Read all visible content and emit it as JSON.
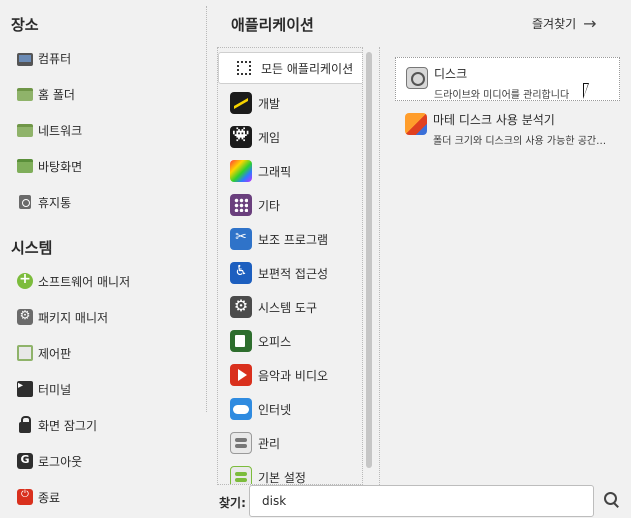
{
  "places": {
    "title": "장소",
    "items": [
      {
        "label": "컴퓨터",
        "icon": "computer-icon"
      },
      {
        "label": "홈 폴더",
        "icon": "home-folder-icon"
      },
      {
        "label": "네트워크",
        "icon": "network-icon"
      },
      {
        "label": "바탕화면",
        "icon": "desktop-icon"
      },
      {
        "label": "휴지통",
        "icon": "trash-icon"
      }
    ]
  },
  "system": {
    "title": "시스템",
    "items": [
      {
        "label": "소프트웨어 매니저",
        "icon": "software-manager-icon"
      },
      {
        "label": "패키지 매니저",
        "icon": "package-manager-icon"
      },
      {
        "label": "제어판",
        "icon": "control-panel-icon"
      },
      {
        "label": "터미널",
        "icon": "terminal-icon"
      },
      {
        "label": "화면 잠그기",
        "icon": "lock-icon"
      },
      {
        "label": "로그아웃",
        "icon": "logout-icon"
      },
      {
        "label": "종료",
        "icon": "power-icon"
      }
    ]
  },
  "applications": {
    "title": "애플리케이션",
    "favorites_label": "즐겨찾기",
    "categories": [
      {
        "label": "모든 애플리케이션",
        "icon": "all-apps-icon",
        "selected": true
      },
      {
        "label": "개발",
        "icon": "development-icon"
      },
      {
        "label": "게임",
        "icon": "games-icon"
      },
      {
        "label": "그래픽",
        "icon": "graphics-icon"
      },
      {
        "label": "기타",
        "icon": "other-icon"
      },
      {
        "label": "보조 프로그램",
        "icon": "accessories-icon"
      },
      {
        "label": "보편적 접근성",
        "icon": "accessibility-icon"
      },
      {
        "label": "시스템 도구",
        "icon": "system-tools-icon"
      },
      {
        "label": "오피스",
        "icon": "office-icon"
      },
      {
        "label": "음악과 비디오",
        "icon": "multimedia-icon"
      },
      {
        "label": "인터넷",
        "icon": "internet-icon"
      },
      {
        "label": "관리",
        "icon": "administration-icon"
      },
      {
        "label": "기본 설정",
        "icon": "preferences-icon"
      }
    ],
    "results": [
      {
        "name": "디스크",
        "description": "드라이브와 미디어를 관리합니다",
        "icon": "disks-icon",
        "selected": true
      },
      {
        "name": "마테 디스크 사용 분석기",
        "description": "폴더 크기와 디스크의 사용 가능한 공간을...",
        "icon": "disk-usage-analyzer-icon"
      }
    ]
  },
  "search": {
    "label": "찾기:",
    "value": "disk"
  }
}
